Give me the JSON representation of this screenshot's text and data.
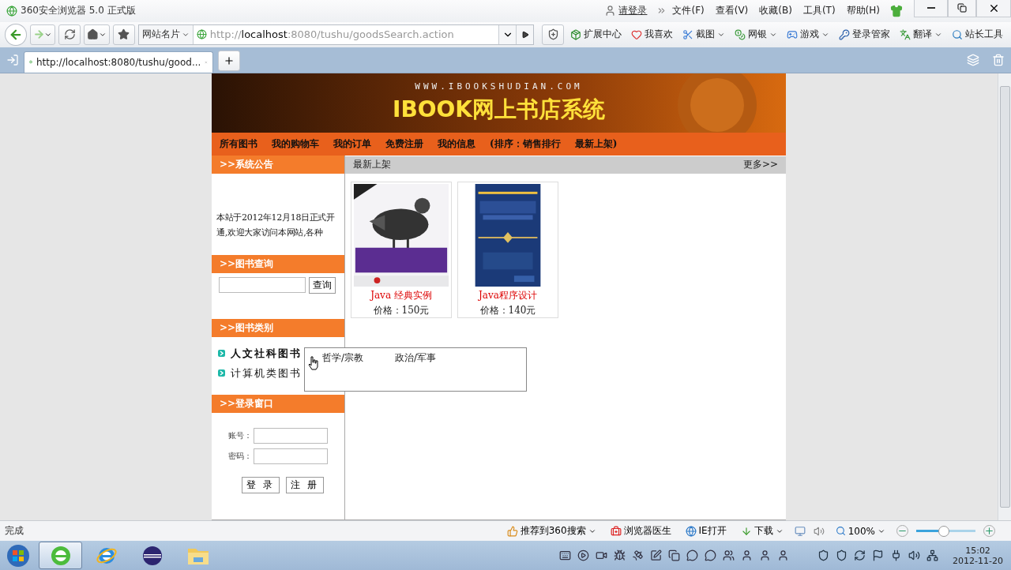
{
  "window": {
    "title": "360安全浏览器 5.0 正式版"
  },
  "menu_bar": {
    "login": "请登录",
    "items": [
      "文件(F)",
      "查看(V)",
      "收藏(B)",
      "工具(T)",
      "帮助(H)"
    ]
  },
  "nav_bar": {
    "site_card": "网站名片",
    "url": {
      "scheme": "http://",
      "host": "localhost",
      "rest": ":8080/tushu/goodsSearch.action"
    }
  },
  "toolbar": [
    {
      "label": "扩展中心",
      "kind": "box",
      "dropdown": false
    },
    {
      "label": "我喜欢",
      "kind": "heart",
      "dropdown": false
    },
    {
      "label": "截图",
      "kind": "scissors",
      "dropdown": true
    },
    {
      "label": "网银",
      "kind": "coin",
      "dropdown": true
    },
    {
      "label": "游戏",
      "kind": "game",
      "dropdown": true
    },
    {
      "label": "登录管家",
      "kind": "key",
      "dropdown": false
    },
    {
      "label": "翻译",
      "kind": "translate",
      "dropdown": true
    },
    {
      "label": "站长工具",
      "kind": "search",
      "dropdown": false
    }
  ],
  "tabs": [
    {
      "title": "http://localhost:8080/tushu/good...",
      "selected": true
    }
  ],
  "page": {
    "banner": {
      "domain": "WWW.IBOOKSHUDIAN.COM",
      "title": "IBOOK网上书店系统"
    },
    "nav": [
      "所有图书",
      "我的购物车",
      "我的订单",
      "免费注册",
      "我的信息",
      "(排序：销售排行",
      "最新上架)"
    ],
    "notice": {
      "heading": ">>系统公告",
      "text": "本站于2012年12月18日正式开通,欢迎大家访问本网站,各种"
    },
    "search": {
      "heading": ">>图书查询",
      "button": "查询"
    },
    "categories": {
      "heading": ">>图书类别",
      "items": [
        {
          "label": "人文社科图书",
          "highlighted": true
        },
        {
          "label": "计算机类图书",
          "highlighted": false
        }
      ]
    },
    "submenu": [
      "哲学/宗教",
      "政治/军事"
    ],
    "login": {
      "heading": ">>登录窗口",
      "fields": [
        "账号：",
        "密码："
      ],
      "buttons": [
        "登 录",
        "注 册"
      ]
    },
    "content": {
      "heading": "最新上架",
      "more": "更多>>",
      "books": [
        {
          "title": "Java 经典实例",
          "price": "价格：150元"
        },
        {
          "title": "Java程序设计",
          "price": "价格：140元"
        }
      ]
    }
  },
  "status_bar": {
    "status": "完成",
    "items": [
      {
        "label": "推荐到360搜索",
        "kind": "thumb",
        "dropdown": true
      },
      {
        "label": "浏览器医生",
        "kind": "medkit",
        "dropdown": false
      },
      {
        "label": "IE打开",
        "kind": "ie",
        "dropdown": false
      },
      {
        "label": "下载",
        "kind": "download",
        "dropdown": true
      }
    ],
    "zoom": {
      "reading": "100%",
      "level": 0.47
    }
  },
  "taskbar": {
    "apps": [
      {
        "kind": "browser360",
        "selected": true
      },
      {
        "kind": "ie",
        "selected": false
      },
      {
        "kind": "eclipse",
        "selected": false
      },
      {
        "kind": "folder",
        "selected": false
      }
    ],
    "clock": {
      "time": "15:02",
      "date": "2012-11-20"
    }
  }
}
